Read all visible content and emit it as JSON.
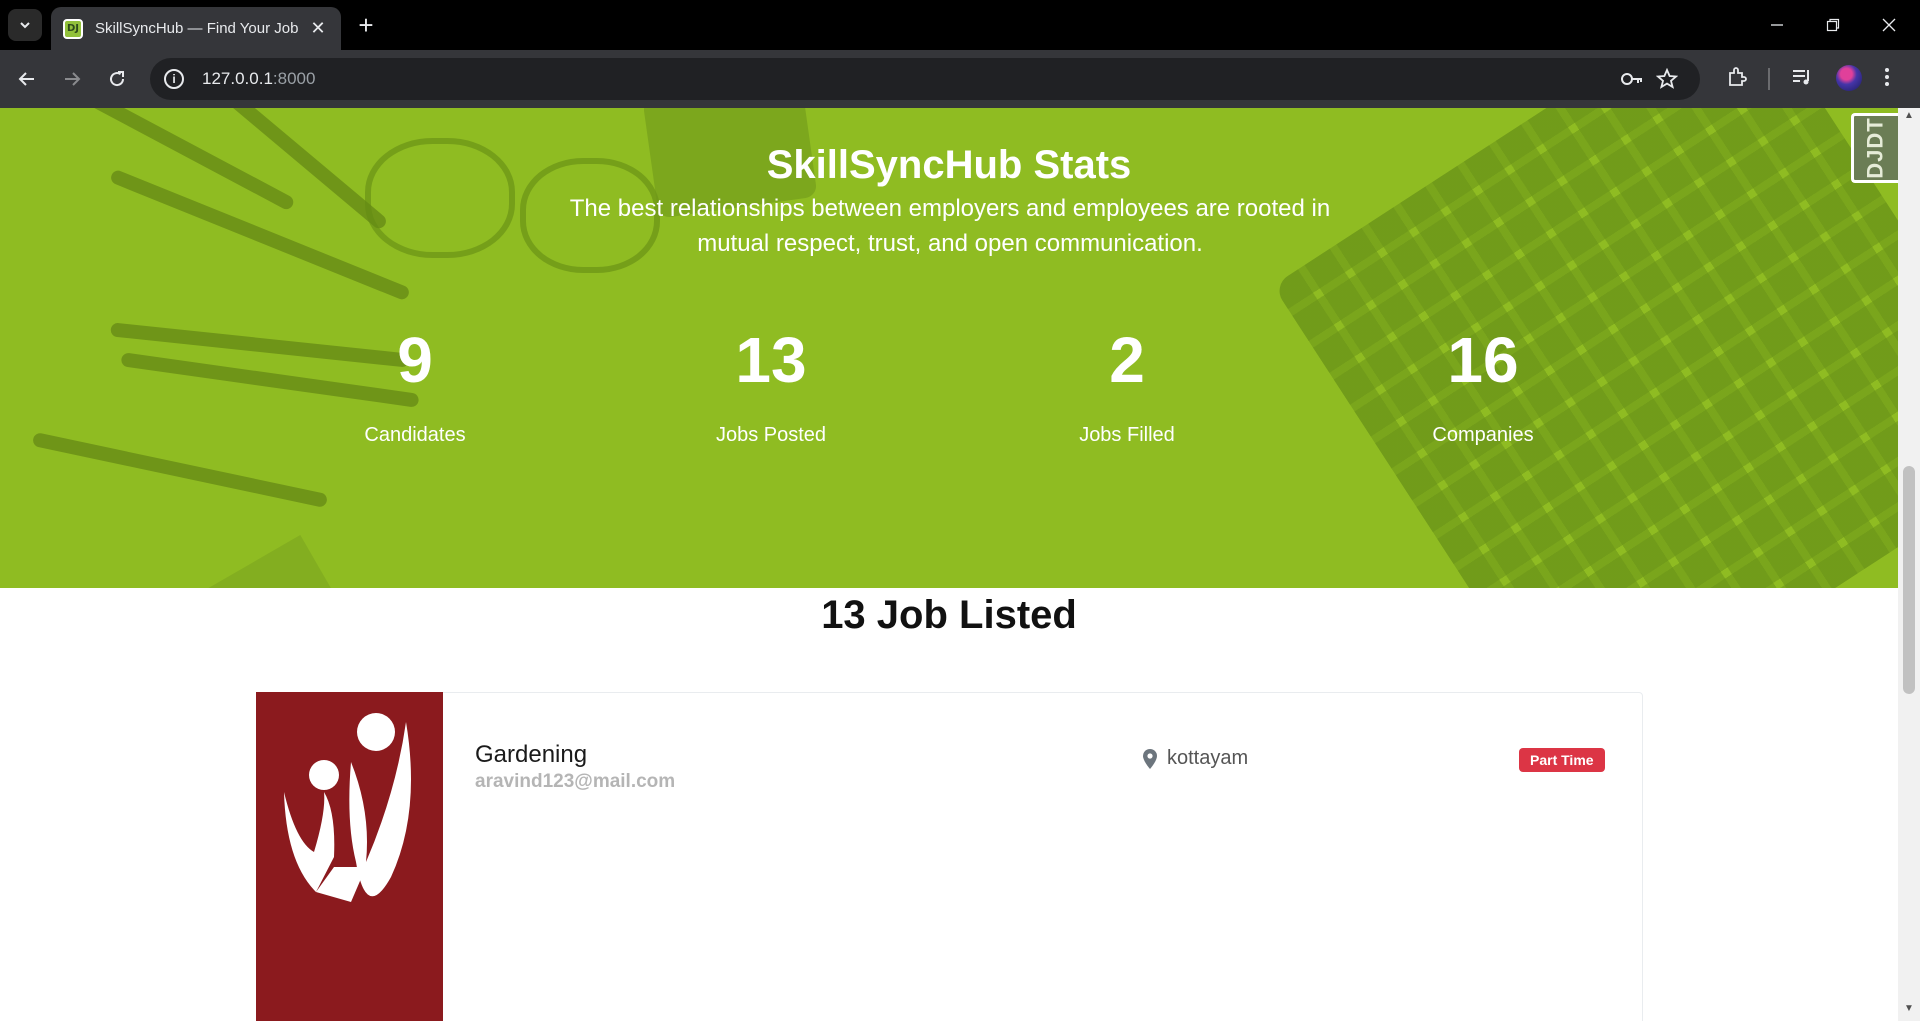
{
  "browser": {
    "tab_title": "SkillSyncHub — Find Your Job",
    "favicon_text": "DJ",
    "url_host": "127.0.0.1",
    "url_port": ":8000",
    "close_symbol": "✕",
    "new_tab_symbol": "+",
    "icons": [
      "tab-search-icon",
      "back-icon",
      "forward-icon",
      "reload-icon",
      "site-info-icon",
      "password-key-icon",
      "bookmark-star-icon",
      "extensions-icon",
      "media-queue-icon",
      "profile-avatar",
      "menu-dots-icon",
      "minimize-icon",
      "restore-icon",
      "window-close-icon"
    ]
  },
  "stats": {
    "title": "SkillSyncHub Stats",
    "subtitle": "The best relationships between employers and employees are rooted in mutual respect, trust, and open communication.",
    "items": [
      {
        "value": "9",
        "label": "Candidates"
      },
      {
        "value": "13",
        "label": "Jobs Posted"
      },
      {
        "value": "2",
        "label": "Jobs Filled"
      },
      {
        "value": "16",
        "label": "Companies"
      }
    ],
    "background_color": "#8fbc22"
  },
  "debug_toolbar": {
    "label": "DJDT"
  },
  "jobs": {
    "heading": "13 Job Listed",
    "items": [
      {
        "title": "Gardening",
        "email": "aravind123@mail.com",
        "location": "kottayam",
        "type": "Part Time",
        "logo_color": "#8b1a1e",
        "badge_color": "#dc3545"
      }
    ]
  }
}
